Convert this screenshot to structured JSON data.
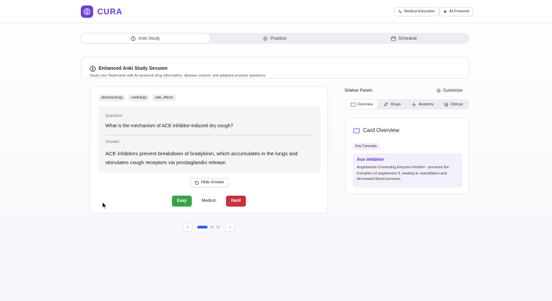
{
  "app": {
    "name": "CURA",
    "badges": [
      {
        "label": "Medical Education",
        "icon": "pulse-icon"
      },
      {
        "label": "AI-Powered",
        "icon": "sparkles-icon"
      }
    ]
  },
  "tabs": [
    {
      "label": "Anki Study",
      "icon": "brain-icon",
      "active": true
    },
    {
      "label": "Practice",
      "icon": "sparkles-icon",
      "active": false
    },
    {
      "label": "Schedule",
      "icon": "calendar-icon",
      "active": false
    }
  ],
  "session": {
    "title": "Enhanced Anki Study Session",
    "subtitle": "Study your flashcards with AI-powered drug information, disease context, and adaptive practice questions"
  },
  "card": {
    "tags": [
      "pharmacology",
      "cardiology",
      "side_effects"
    ],
    "question_label": "Question:",
    "question": "What is the mechanism of ACE inhibitor-induced dry cough?",
    "answer_label": "Answer:",
    "answer": "ACE inhibitors prevent breakdown of bradykinin, which accumulates in the lungs and stimulates cough receptors via prostaglandin release.",
    "hide_label": "Hide Answer",
    "difficulty": {
      "easy": "Easy",
      "medium": "Medium",
      "hard": "Hard"
    }
  },
  "pager": {
    "prev": "‹",
    "next": "›",
    "current": 1,
    "total": 3
  },
  "sidebar": {
    "title": "Sidebar Panels",
    "customize": "Customize",
    "tabs": [
      {
        "label": "Overview",
        "icon": "book-icon",
        "active": true
      },
      {
        "label": "Drugs",
        "icon": "pill-icon",
        "active": false
      },
      {
        "label": "Anatomy",
        "icon": "pulse-icon",
        "active": false
      },
      {
        "label": "Clinical",
        "icon": "stethoscope-icon",
        "active": false
      }
    ],
    "overview": {
      "title": "Card Overview",
      "key_concepts": "Key Concepts",
      "concept_name": "Ace inhibitor",
      "concept_desc": "Angiotensin-Converting Enzyme inhibitor - prevents the formation of angiotensin II, leading to vasodilation and decreased blood pressure."
    }
  },
  "colors": {
    "brand": "#6d3fd6",
    "easy": "#3aa34a",
    "hard": "#c9323c",
    "active_dot": "#2f5fe0"
  }
}
